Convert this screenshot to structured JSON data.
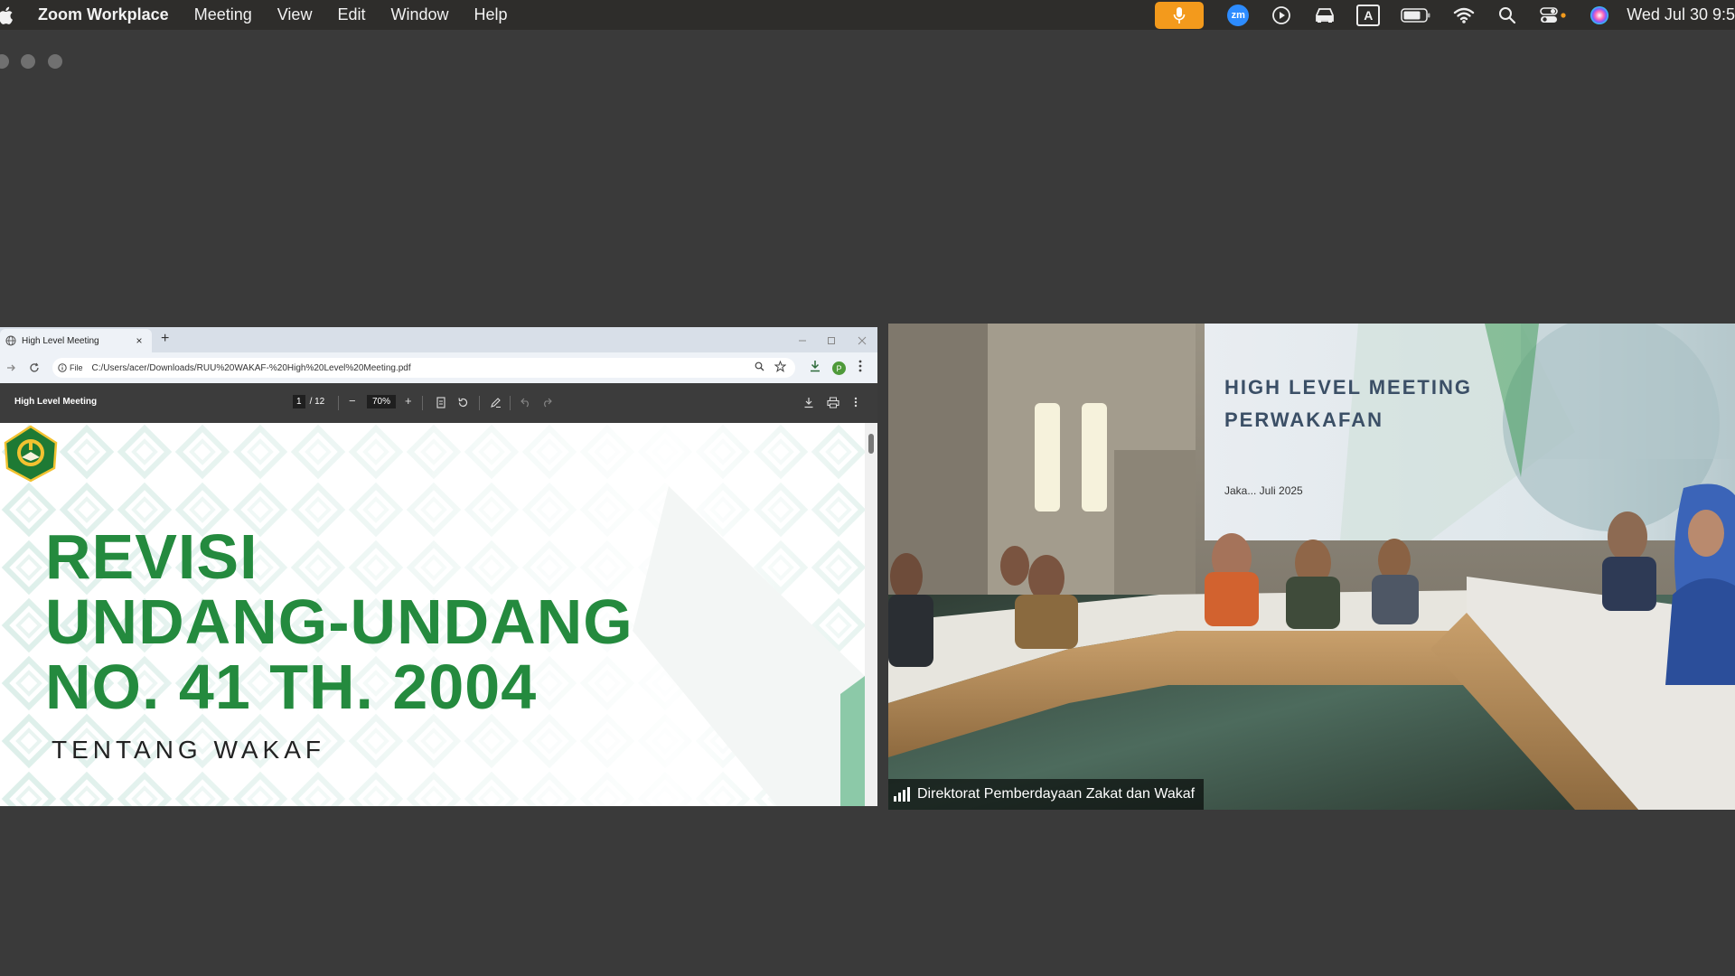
{
  "menubar": {
    "app_name": "Zoom Workplace",
    "menus": [
      "Meeting",
      "View",
      "Edit",
      "Window",
      "Help"
    ],
    "clock": "Wed Jul 30  9:5",
    "mic_color": "#f39a1c",
    "zoom_badge": "zm",
    "input_source": "A",
    "icons": [
      "apple-icon",
      "microphone-icon",
      "zoom-icon",
      "play-icon",
      "car-icon",
      "input-source-icon",
      "battery-icon",
      "wifi-icon",
      "search-icon",
      "control-center-icon",
      "siri-icon"
    ]
  },
  "browser": {
    "tab_title": "High Level Meeting",
    "tab_close": "×",
    "new_tab": "+",
    "file_label": "File",
    "url": "C:/Users/acer/Downloads/RUU%20WAKAF-%20High%20Level%20Meeting.pdf",
    "profile_initial": "P"
  },
  "pdf": {
    "title": "High Level Meeting",
    "page_current": "1",
    "page_total": "/ 12",
    "zoom": "70%",
    "zoom_out": "−",
    "zoom_in": "+"
  },
  "slide": {
    "lines": [
      "REVISI",
      "UNDANG-UNDANG",
      "NO. 41 TH. 2004"
    ],
    "subtitle": "TENTANG WAKAF",
    "accent": "#248a3e"
  },
  "video": {
    "participant_name": "Direktorat Pemberdayaan Zakat dan Wakaf",
    "banner_line1": "HIGH LEVEL MEETING",
    "banner_line2": "PERWAKAFAN",
    "banner_date": "Jaka...  Juli 2025"
  }
}
